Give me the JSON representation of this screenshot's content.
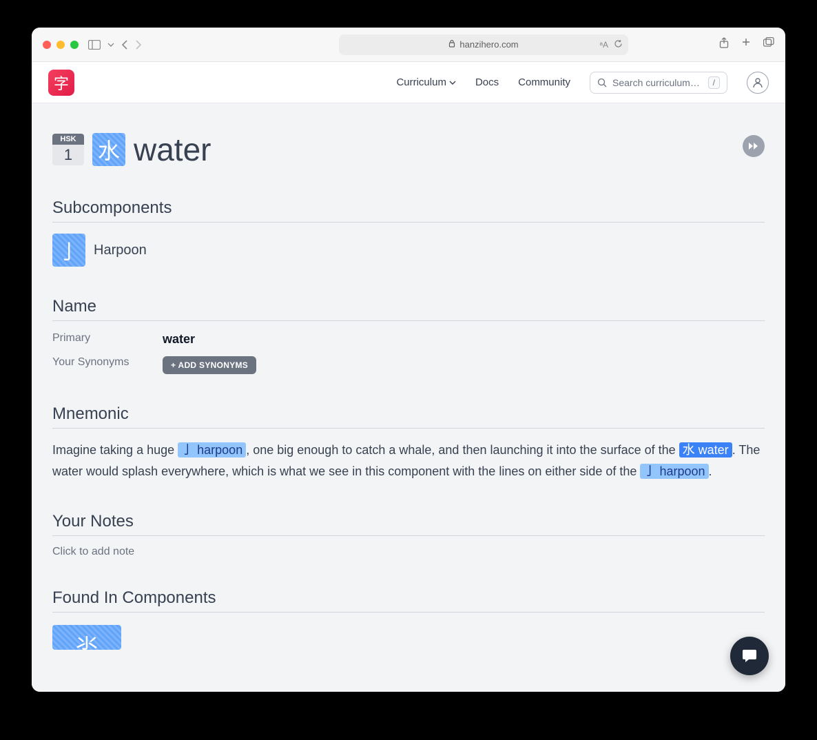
{
  "browser": {
    "domain": "hanzihero.com"
  },
  "logo_char": "字",
  "nav": {
    "curriculum": "Curriculum",
    "docs": "Docs",
    "community": "Community"
  },
  "search": {
    "placeholder": "Search curriculum…",
    "shortcut": "/"
  },
  "level": {
    "system": "HSK",
    "number": "1"
  },
  "hanzi": "水",
  "title": "water",
  "sections": {
    "subcomponents": "Subcomponents",
    "name": "Name",
    "mnemonic": "Mnemonic",
    "notes": "Your Notes",
    "found_in": "Found In Components"
  },
  "subcomponents": [
    {
      "glyph": "亅",
      "name": "Harpoon"
    }
  ],
  "name": {
    "primary_label": "Primary",
    "primary_value": "water",
    "synonyms_label": "Your Synonyms",
    "add_synonyms_btn": "+ ADD SYNONYMS"
  },
  "mnemonic": {
    "t1": "Imagine taking a huge ",
    "ref1": "亅 harpoon",
    "t2": ", one big enough to catch a whale, and then launching it into the surface of the ",
    "ref2": "水 water",
    "t3": ". The water would splash everywhere, which is what we see in this component with the lines on either side of the ",
    "ref3": "亅 harpoon",
    "t4": "."
  },
  "notes": {
    "placeholder": "Click to add note"
  },
  "found_in_glyph": "氺"
}
